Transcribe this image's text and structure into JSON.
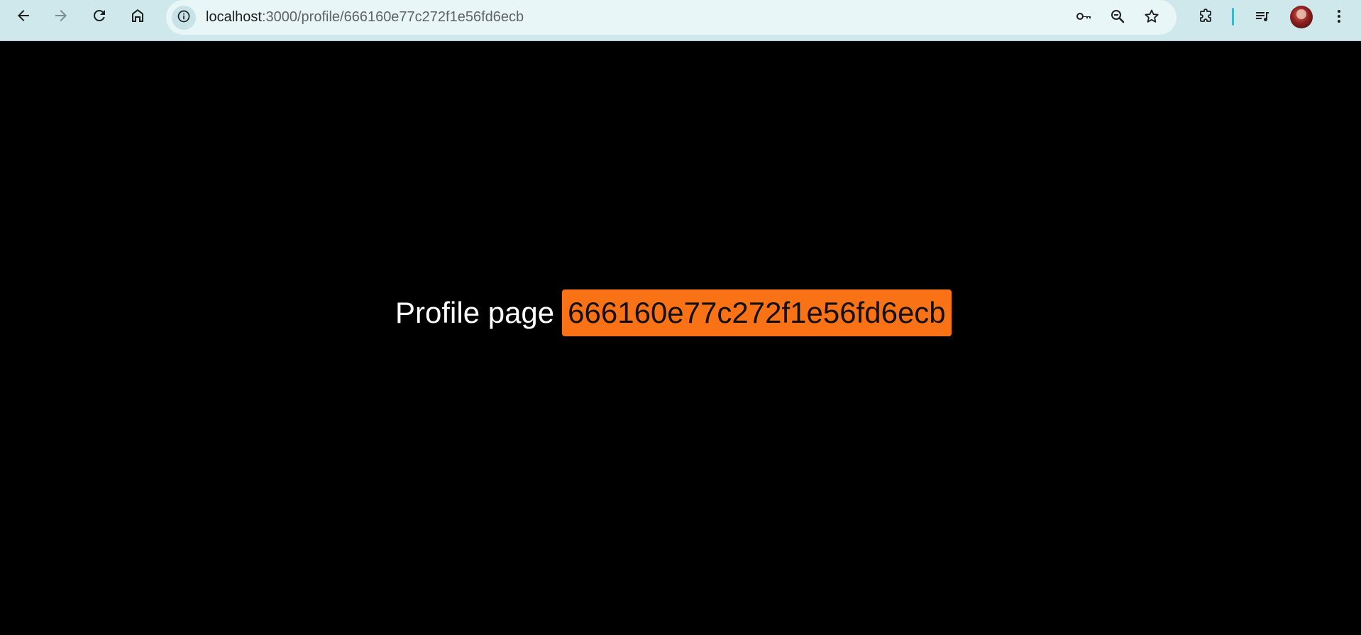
{
  "browser": {
    "url": {
      "host": "localhost",
      "path": ":3000/profile/666160e77c272f1e56fd6ecb"
    },
    "nav": {
      "back_icon": "arrow-left-icon",
      "forward_icon": "arrow-right-icon",
      "reload_icon": "reload-icon",
      "home_icon": "home-icon"
    },
    "omnibox_icons": [
      "key-icon",
      "zoom-icon",
      "star-icon"
    ],
    "toolbar_icons": [
      "extensions-icon",
      "media-controls-icon",
      "avatar",
      "kebab-menu-icon"
    ],
    "colors": {
      "toolbar_bg": "#cfe8ec",
      "omnibox_bg": "#e8f6f8",
      "divider": "#3fb6c9"
    }
  },
  "page": {
    "heading_label": "Profile page",
    "profile_id": "666160e77c272f1e56fd6ecb",
    "colors": {
      "background": "#000000",
      "text": "#ffffff",
      "highlight": "#f97316"
    }
  }
}
